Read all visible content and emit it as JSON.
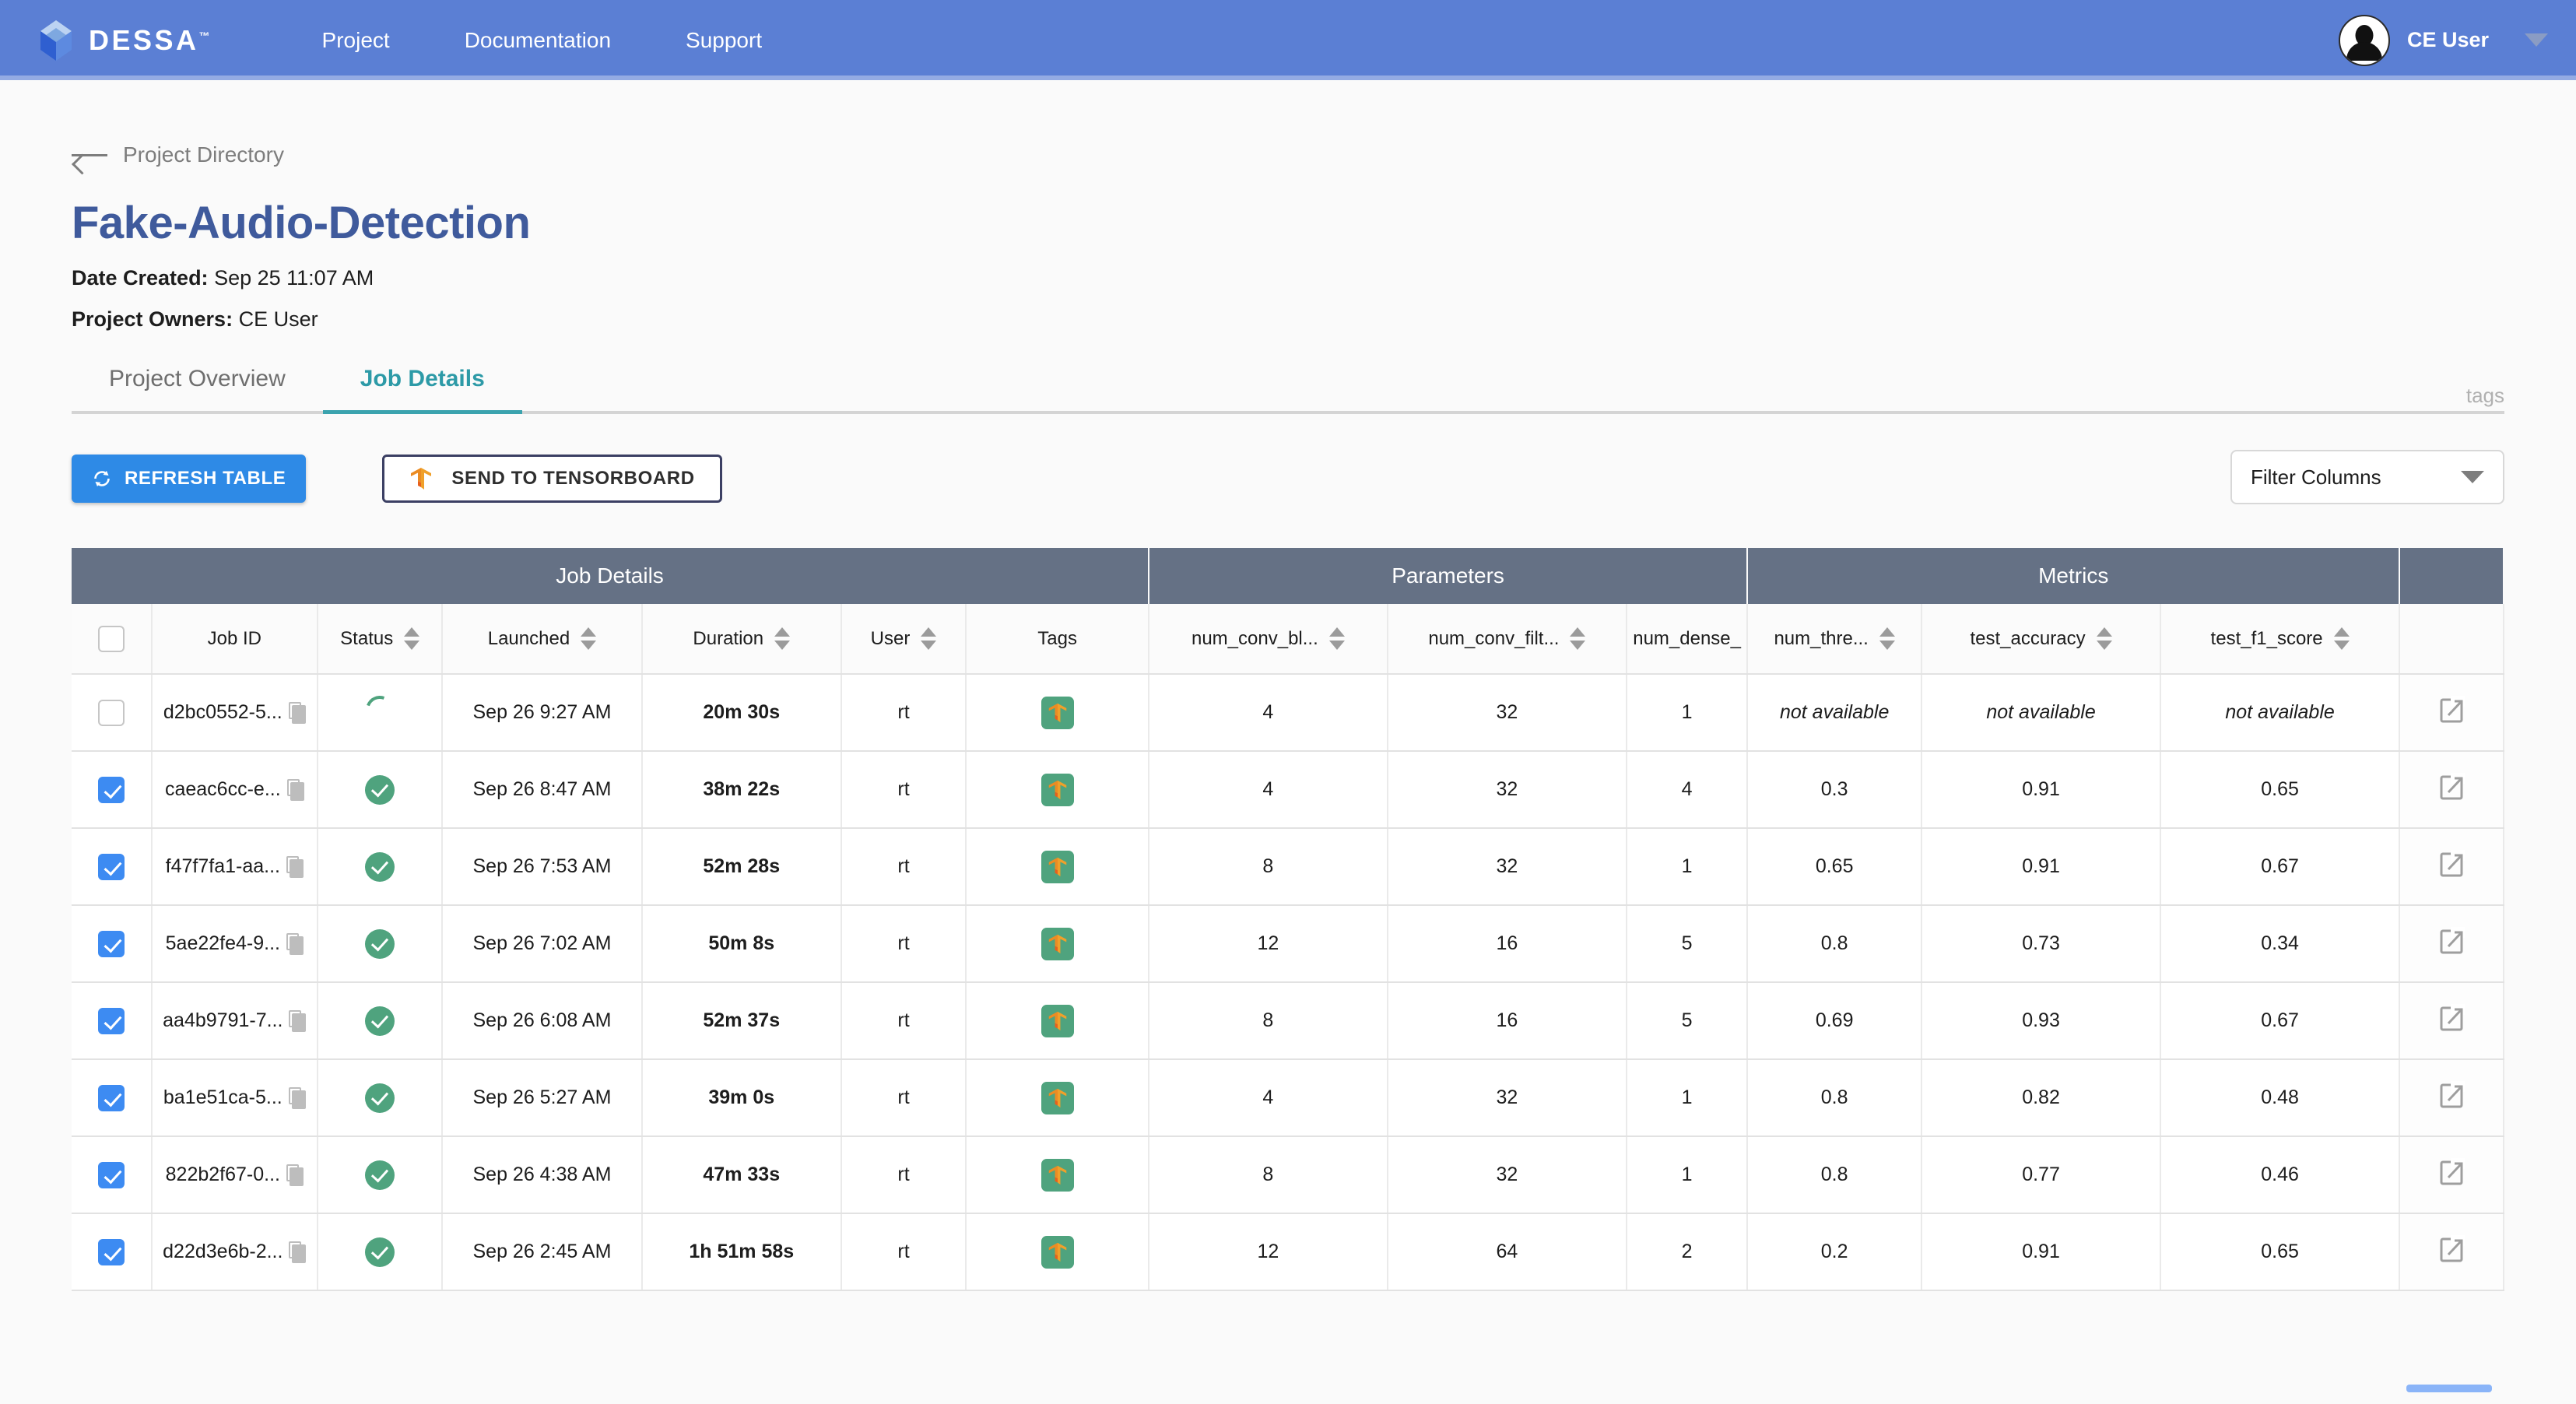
{
  "nav": {
    "brand": "DESSA",
    "brand_tm": "™",
    "links": [
      "Project",
      "Documentation",
      "Support"
    ],
    "user": "CE User",
    "avatar_icon": "user-avatar-icon",
    "caret_icon": "chevron-down-icon"
  },
  "breadcrumb": {
    "back_icon": "arrow-left-icon",
    "label": "Project Directory"
  },
  "project": {
    "title": "Fake-Audio-Detection",
    "tags_label": "tags",
    "date_created_label": "Date Created:",
    "date_created_value": "Sep 25 11:07 AM",
    "owners_label": "Project Owners:",
    "owners_value": "CE User"
  },
  "tabs": [
    {
      "label": "Project Overview",
      "active": false
    },
    {
      "label": "Job Details",
      "active": true
    }
  ],
  "toolbar": {
    "refresh_label": "REFRESH TABLE",
    "refresh_icon": "refresh-icon",
    "tensorboard_label": "SEND TO TENSORBOARD",
    "tensorboard_icon": "tensorflow-icon",
    "filter_value": "Filter Columns",
    "filter_caret_icon": "chevron-down-icon"
  },
  "table": {
    "groups": [
      {
        "label": "Job Details",
        "span": 7
      },
      {
        "label": "Parameters",
        "span": 3
      },
      {
        "label": "Metrics",
        "span": 3
      },
      {
        "label": "",
        "span": 1
      }
    ],
    "columns": [
      {
        "label": "",
        "sortable": false,
        "key": "select"
      },
      {
        "label": "Job ID",
        "sortable": false,
        "key": "job_id"
      },
      {
        "label": "Status",
        "sortable": true,
        "key": "status"
      },
      {
        "label": "Launched",
        "sortable": true,
        "key": "launched"
      },
      {
        "label": "Duration",
        "sortable": true,
        "key": "duration"
      },
      {
        "label": "User",
        "sortable": true,
        "key": "user"
      },
      {
        "label": "Tags",
        "sortable": false,
        "key": "tags"
      },
      {
        "label": "num_conv_bl...",
        "sortable": true,
        "key": "num_conv_blocks"
      },
      {
        "label": "num_conv_filt...",
        "sortable": true,
        "key": "num_conv_filters"
      },
      {
        "label": "num_dense_",
        "sortable": false,
        "key": "num_dense"
      },
      {
        "label": "num_thre...",
        "sortable": true,
        "key": "num_threshold"
      },
      {
        "label": "test_accuracy",
        "sortable": true,
        "key": "test_accuracy"
      },
      {
        "label": "test_f1_score",
        "sortable": true,
        "key": "test_f1_score"
      },
      {
        "label": "",
        "sortable": false,
        "key": "open"
      }
    ],
    "header_checkbox_checked": false,
    "rows": [
      {
        "selected": false,
        "job_id": "d2bc0552-5...",
        "status": "running",
        "launched": "Sep 26 9:27 AM",
        "duration": "20m 30s",
        "user": "rt",
        "tag": "tensorflow-icon",
        "num_conv_blocks": "4",
        "num_conv_filters": "32",
        "num_dense": "1",
        "num_threshold": "not available",
        "test_accuracy": "not available",
        "test_f1_score": "not available",
        "na": true
      },
      {
        "selected": true,
        "job_id": "caeac6cc-e...",
        "status": "complete",
        "launched": "Sep 26 8:47 AM",
        "duration": "38m 22s",
        "user": "rt",
        "tag": "tensorflow-icon",
        "num_conv_blocks": "4",
        "num_conv_filters": "32",
        "num_dense": "4",
        "num_threshold": "0.3",
        "test_accuracy": "0.91",
        "test_f1_score": "0.65",
        "na": false
      },
      {
        "selected": true,
        "job_id": "f47f7fa1-aa...",
        "status": "complete",
        "launched": "Sep 26 7:53 AM",
        "duration": "52m 28s",
        "user": "rt",
        "tag": "tensorflow-icon",
        "num_conv_blocks": "8",
        "num_conv_filters": "32",
        "num_dense": "1",
        "num_threshold": "0.65",
        "test_accuracy": "0.91",
        "test_f1_score": "0.67",
        "na": false
      },
      {
        "selected": true,
        "job_id": "5ae22fe4-9...",
        "status": "complete",
        "launched": "Sep 26 7:02 AM",
        "duration": "50m 8s",
        "user": "rt",
        "tag": "tensorflow-icon",
        "num_conv_blocks": "12",
        "num_conv_filters": "16",
        "num_dense": "5",
        "num_threshold": "0.8",
        "test_accuracy": "0.73",
        "test_f1_score": "0.34",
        "na": false
      },
      {
        "selected": true,
        "job_id": "aa4b9791-7...",
        "status": "complete",
        "launched": "Sep 26 6:08 AM",
        "duration": "52m 37s",
        "user": "rt",
        "tag": "tensorflow-icon",
        "num_conv_blocks": "8",
        "num_conv_filters": "16",
        "num_dense": "5",
        "num_threshold": "0.69",
        "test_accuracy": "0.93",
        "test_f1_score": "0.67",
        "na": false
      },
      {
        "selected": true,
        "job_id": "ba1e51ca-5...",
        "status": "complete",
        "launched": "Sep 26 5:27 AM",
        "duration": "39m 0s",
        "user": "rt",
        "tag": "tensorflow-icon",
        "num_conv_blocks": "4",
        "num_conv_filters": "32",
        "num_dense": "1",
        "num_threshold": "0.8",
        "test_accuracy": "0.82",
        "test_f1_score": "0.48",
        "na": false
      },
      {
        "selected": true,
        "job_id": "822b2f67-0...",
        "status": "complete",
        "launched": "Sep 26 4:38 AM",
        "duration": "47m 33s",
        "user": "rt",
        "tag": "tensorflow-icon",
        "num_conv_blocks": "8",
        "num_conv_filters": "32",
        "num_dense": "1",
        "num_threshold": "0.8",
        "test_accuracy": "0.77",
        "test_f1_score": "0.46",
        "na": false
      },
      {
        "selected": true,
        "job_id": "d22d3e6b-2...",
        "status": "complete",
        "launched": "Sep 26 2:45 AM",
        "duration": "1h 51m 58s",
        "user": "rt",
        "tag": "tensorflow-icon",
        "num_conv_blocks": "12",
        "num_conv_filters": "64",
        "num_dense": "2",
        "num_threshold": "0.2",
        "test_accuracy": "0.91",
        "test_f1_score": "0.65",
        "na": false
      }
    ]
  },
  "colors": {
    "nav_blue": "#5b7fd4",
    "title_blue": "#3f5a9c",
    "tab_active": "#3ba3ae",
    "button_blue": "#2e8ae6",
    "group_header": "#657185",
    "status_green": "#4fa37e",
    "checkbox_blue": "#3d8bf2",
    "scrollbar_blue": "#8ab4f8"
  }
}
